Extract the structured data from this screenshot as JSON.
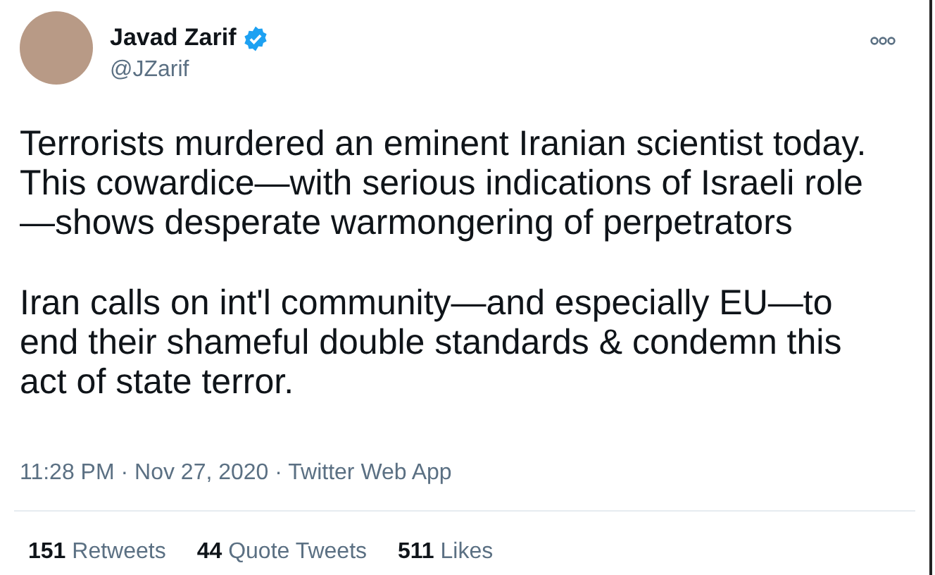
{
  "tweet": {
    "author": {
      "name": "Javad Zarif",
      "verified": true,
      "handle": "@JZarif"
    },
    "paragraphs": [
      "Terrorists murdered an eminent Iranian scientist today.\nThis cowardice—with serious indications of Israeli role\n—shows desperate warmongering of perpetrators",
      "Iran calls on int'l community—and especially EU—to\nend their shameful double standards & condemn this\nact of state terror."
    ],
    "timestamp": "11:28 PM · Nov 27, 2020 · Twitter Web App",
    "stats": [
      {
        "count": "151",
        "label": "Retweets"
      },
      {
        "count": "44",
        "label": "Quote Tweets"
      },
      {
        "count": "511",
        "label": "Likes"
      }
    ]
  }
}
